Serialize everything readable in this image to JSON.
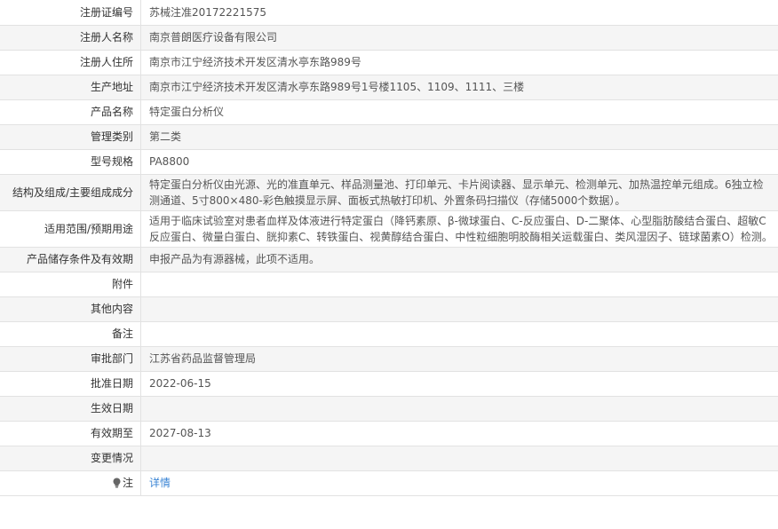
{
  "rows": [
    {
      "label": "注册证编号",
      "value": "苏械注准20172221575"
    },
    {
      "label": "注册人名称",
      "value": "南京普朗医疗设备有限公司"
    },
    {
      "label": "注册人住所",
      "value": "南京市江宁经济技术开发区清水亭东路989号"
    },
    {
      "label": "生产地址",
      "value": "南京市江宁经济技术开发区清水亭东路989号1号楼1105、1109、1111、三楼"
    },
    {
      "label": "产品名称",
      "value": "特定蛋白分析仪"
    },
    {
      "label": "管理类别",
      "value": "第二类"
    },
    {
      "label": "型号规格",
      "value": "PA8800"
    },
    {
      "label": "结构及组成/主要组成成分",
      "value": "特定蛋白分析仪由光源、光的准直单元、样品测量池、打印单元、卡片阅读器、显示单元、检测单元、加热温控单元组成。6独立检测通道、5寸800×480-彩色触摸显示屏、面板式热敏打印机、外置条码扫描仪（存储5000个数据）。"
    },
    {
      "label": "适用范围/预期用途",
      "value": "适用于临床试验室对患者血样及体液进行特定蛋白（降钙素原、β-微球蛋白、C-反应蛋白、D-二聚体、心型脂肪酸结合蛋白、超敏C反应蛋白、微量白蛋白、胱抑素C、转铁蛋白、视黄醇结合蛋白、中性粒细胞明胶酶相关运载蛋白、类风湿因子、链球菌素O）检测。"
    },
    {
      "label": "产品储存条件及有效期",
      "value": "申报产品为有源器械，此项不适用。"
    },
    {
      "label": "附件",
      "value": ""
    },
    {
      "label": "其他内容",
      "value": ""
    },
    {
      "label": "备注",
      "value": ""
    },
    {
      "label": "审批部门",
      "value": "江苏省药品监督管理局"
    },
    {
      "label": "批准日期",
      "value": "2022-06-15"
    },
    {
      "label": "生效日期",
      "value": ""
    },
    {
      "label": "有效期至",
      "value": "2027-08-13"
    },
    {
      "label": "变更情况",
      "value": ""
    }
  ],
  "note": {
    "label": "注",
    "icon": "lightbulb-icon",
    "link_text": "详情",
    "link_color": "#3a84d4"
  }
}
